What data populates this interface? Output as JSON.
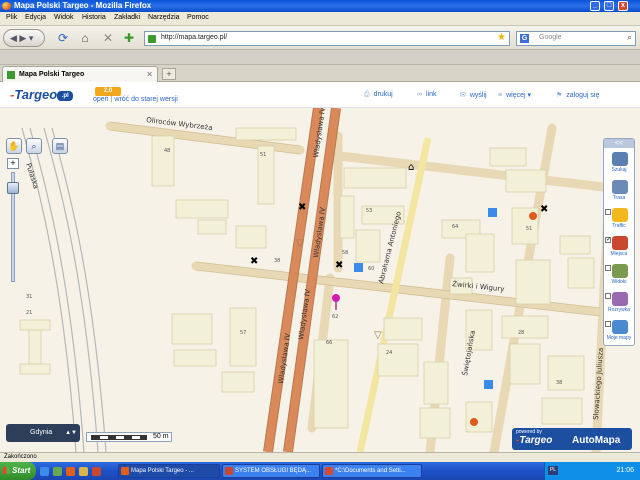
{
  "window": {
    "title": "Mapa Polski Targeo - Mozilla Firefox",
    "buttons": [
      "_",
      "□",
      "x"
    ]
  },
  "menu": [
    "Plik",
    "Edycja",
    "Widok",
    "Historia",
    "Zakładki",
    "Narzędzia",
    "Pomoc"
  ],
  "navbar": {
    "url": "http://mapa.targeo.pl/",
    "search_placeholder": "Google"
  },
  "tabs": [
    {
      "label": "Mapa Polski Targeo",
      "active": true
    }
  ],
  "page": {
    "logo": "Targeo",
    "version_badge": "2.0",
    "link_help": "opeń",
    "link_old": "wróć do starej wersji",
    "header_buttons": [
      {
        "label": "drukuj",
        "icon": "print-icon"
      },
      {
        "label": "link",
        "icon": "link-icon"
      },
      {
        "label": "wyślij",
        "icon": "mail-icon"
      },
      {
        "label": "więcej ▾",
        "icon": "more-icon"
      },
      {
        "label": "zaloguj się",
        "icon": "login-icon"
      }
    ]
  },
  "map": {
    "streets": {
      "s1": "Oliroców Wybrzeża",
      "s2": "Władysława IV",
      "s3": "Władysława IV",
      "s4": "Władysława IV",
      "s5": "Władysława IV",
      "s6": "Abrahama Antoniego",
      "s7": "Żwirki i Wigury",
      "s8": "Świętojańska",
      "s9": "Słowackiego Juliusza",
      "s10": "Pułaska"
    },
    "numbers": [
      "51",
      "48",
      "38",
      "53",
      "58",
      "60",
      "64",
      "62",
      "66",
      "57",
      "51",
      "31",
      "21",
      "38",
      "24",
      "28"
    ],
    "scale": "50 m",
    "city_selector": "Gdynia",
    "powered_by": "powered by",
    "powered_brand1": "Targeo",
    "powered_brand2": "AutoMapa",
    "side_panel": [
      {
        "label": "Szukaj",
        "icon": "search-icon",
        "checked": false
      },
      {
        "label": "Trasa",
        "icon": "route-icon",
        "checked": false
      },
      {
        "label": "Traffic",
        "icon": "traffic-icon",
        "checked": false
      },
      {
        "label": "Miejsca",
        "icon": "poi-icon",
        "checked": true
      },
      {
        "label": "Widoki",
        "icon": "photos-icon",
        "checked": false
      },
      {
        "label": "Rozrywka",
        "icon": "fun-icon",
        "checked": false
      },
      {
        "label": "Moje mapy",
        "icon": "mymaps-icon",
        "checked": false
      }
    ],
    "collapse_label": "<<",
    "zoom_level_fraction": 0.9
  },
  "statusbar": {
    "text": "Zakończono"
  },
  "taskbar": {
    "start": "Start",
    "tasks": [
      {
        "label": "Mapa Polski Targeo - ...",
        "active": true
      },
      {
        "label": "SYSTEM OBSŁUGI BĘDĄ...",
        "active": false
      },
      {
        "label": "*C:\\Documents and Setti...",
        "active": false
      }
    ],
    "lang": "PL",
    "clock": "21:06"
  },
  "colors": {
    "main_road": "#d9895a",
    "road": "#e8d8b4",
    "building": "#f2f0d6",
    "link": "#2a66c4",
    "brand": "#1d4fa0"
  }
}
